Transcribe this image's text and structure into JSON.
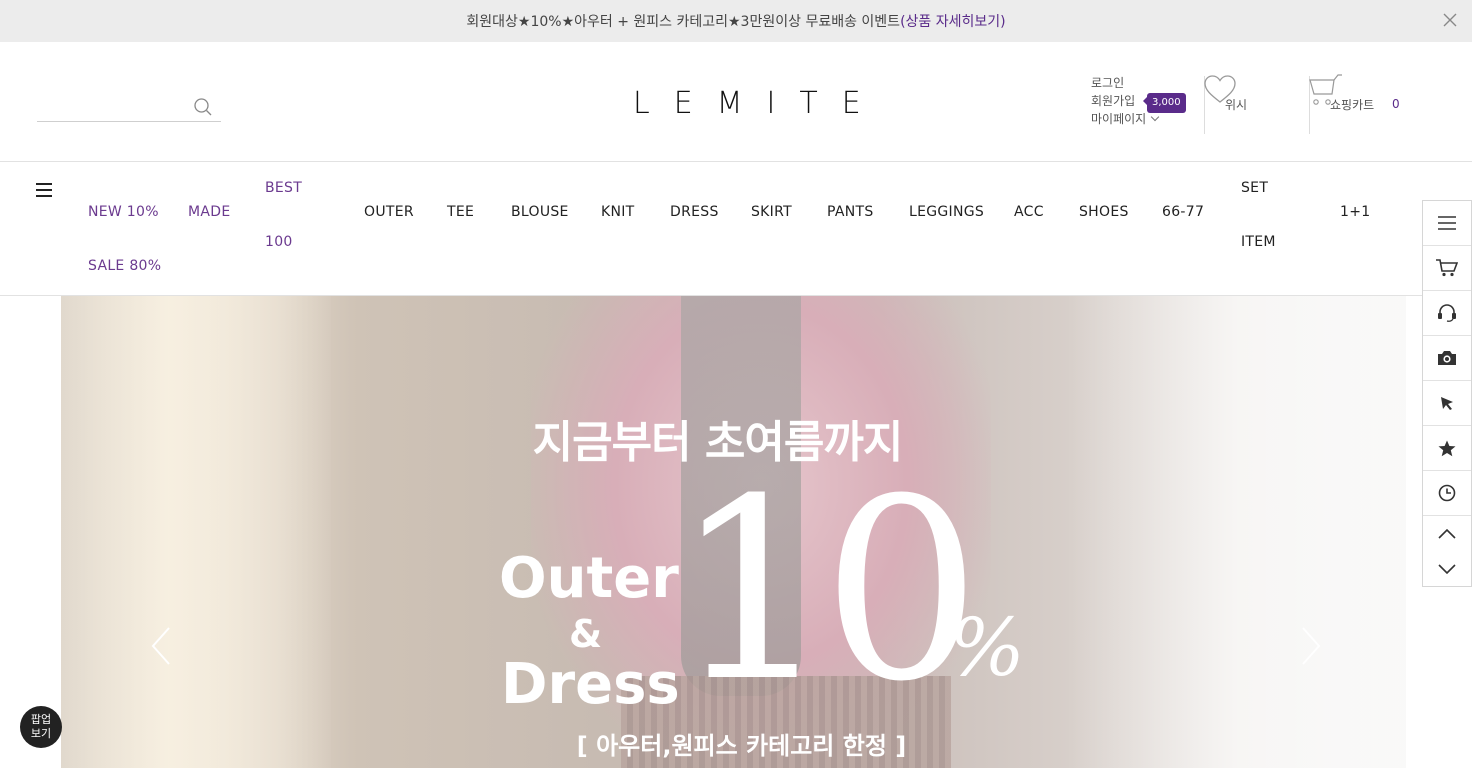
{
  "topbar": {
    "message": "회원대상★10%★아우터 + 원피스 카테고리★3만원이상 무료배송 이벤트",
    "link": "(상품 자세히보기)"
  },
  "header": {
    "search_placeholder": "",
    "logo": "LEMITE",
    "member": {
      "login": "로그인",
      "join": "회원가입",
      "join_badge": "3,000",
      "mypage": "마이페이지"
    },
    "wish_label": "위시",
    "cart_label": "쇼핑카트",
    "cart_count": "0"
  },
  "nav": {
    "items": [
      {
        "label": "NEW 10%"
      },
      {
        "label": "SALE 80%"
      },
      {
        "label": "MADE"
      },
      {
        "label": "BEST"
      },
      {
        "label": "100"
      },
      {
        "label": "OUTER"
      },
      {
        "label": "TEE"
      },
      {
        "label": "BLOUSE"
      },
      {
        "label": "KNIT"
      },
      {
        "label": "DRESS"
      },
      {
        "label": "SKIRT"
      },
      {
        "label": "PANTS"
      },
      {
        "label": "LEGGINGS"
      },
      {
        "label": "ACC"
      },
      {
        "label": "SHOES"
      },
      {
        "label": "66-77"
      },
      {
        "label": "SET"
      },
      {
        "label": "ITEM"
      },
      {
        "label": "1+1"
      }
    ]
  },
  "hero": {
    "headline": "지금부터 초여름까지",
    "outer": "Outer",
    "amp": "&",
    "dress": "Dress",
    "big_number": "10",
    "percent": "%",
    "sub": "[ 아우터,원피스 카테고리 한정 ]"
  },
  "popup": {
    "line1": "팝업",
    "line2": "보기"
  },
  "colors": {
    "accent": "#5a2b8a",
    "nav_purple": "#6b3a8f"
  }
}
